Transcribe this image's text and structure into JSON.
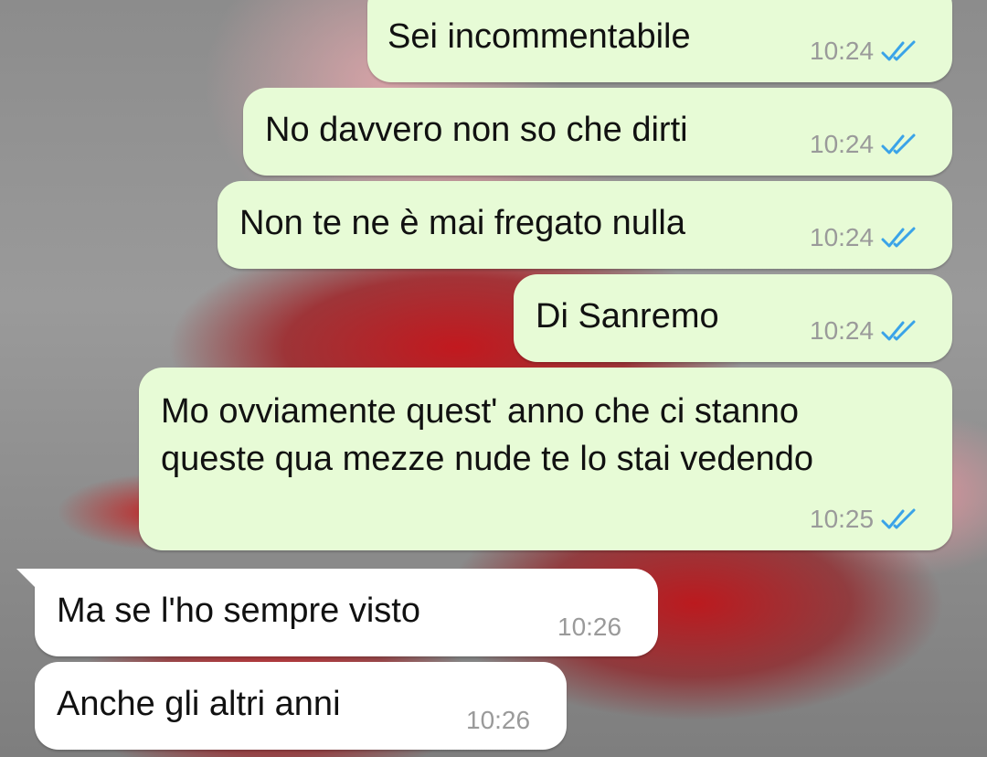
{
  "messages": [
    {
      "text": "Sei incommentabile",
      "time": "10:24",
      "direction": "outgoing",
      "status": "read"
    },
    {
      "text": "No davvero non so che dirti",
      "time": "10:24",
      "direction": "outgoing",
      "status": "read"
    },
    {
      "text": "Non te ne è mai fregato nulla",
      "time": "10:24",
      "direction": "outgoing",
      "status": "read"
    },
    {
      "text": "Di Sanremo",
      "time": "10:24",
      "direction": "outgoing",
      "status": "read"
    },
    {
      "text_line1": "Mo ovviamente quest' anno che ci stanno",
      "text_line2": "queste qua mezze nude te lo stai vedendo",
      "time": "10:25",
      "direction": "outgoing",
      "status": "read"
    },
    {
      "text": "Ma se l'ho sempre visto",
      "time": "10:26",
      "direction": "incoming"
    },
    {
      "text": "Anche gli altri anni",
      "time": "10:26",
      "direction": "incoming"
    }
  ],
  "colors": {
    "outgoing_bubble": "#e7fbd6",
    "incoming_bubble": "#ffffff",
    "read_ticks": "#3aa3e8",
    "timestamp": "#9a9a9a"
  },
  "icons": {
    "read_status": "double-check-icon"
  }
}
